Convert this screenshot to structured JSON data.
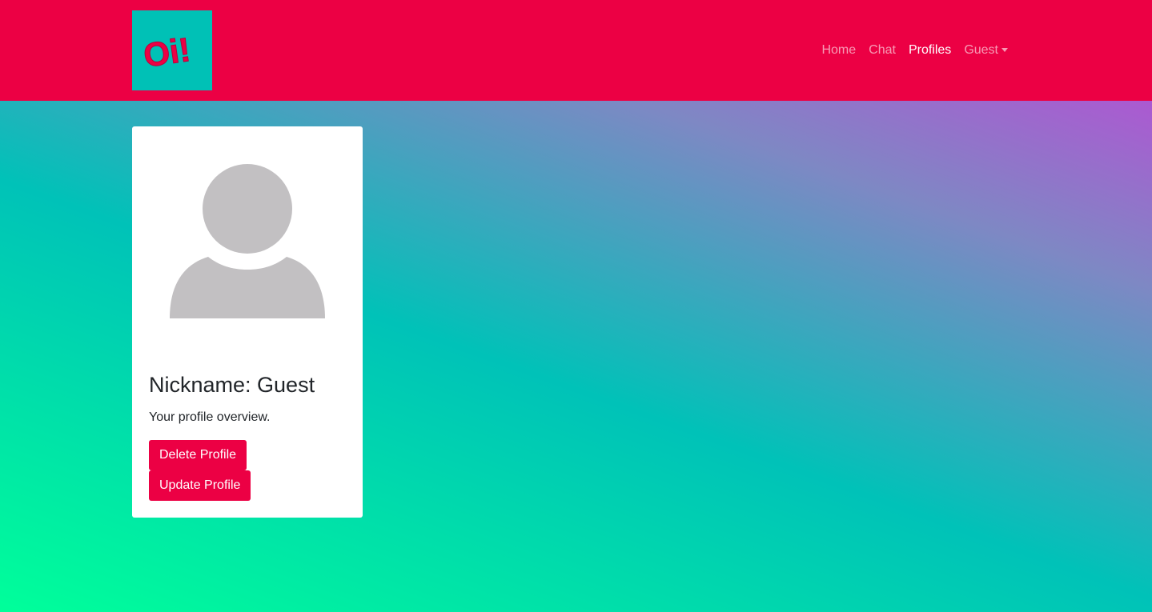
{
  "brand": {
    "logo_text": "Oi!",
    "logo_bg": "#00c1b6",
    "logo_fg": "#ec0044"
  },
  "navbar": {
    "bg_color": "#ec0044",
    "links": [
      {
        "label": "Home",
        "active": false
      },
      {
        "label": "Chat",
        "active": false
      },
      {
        "label": "Profiles",
        "active": true
      },
      {
        "label": "Guest",
        "active": false,
        "dropdown": true
      }
    ]
  },
  "profile_card": {
    "avatar_icon": "user-placeholder-icon",
    "title": "Nickname: Guest",
    "description": "Your profile overview.",
    "delete_label": "Delete Profile",
    "update_label": "Update Profile",
    "button_color": "#ec0044"
  },
  "background": {
    "gradient_colors": [
      "#c440d8",
      "#7e88c4",
      "#00c2b8",
      "#00ff9a"
    ]
  }
}
